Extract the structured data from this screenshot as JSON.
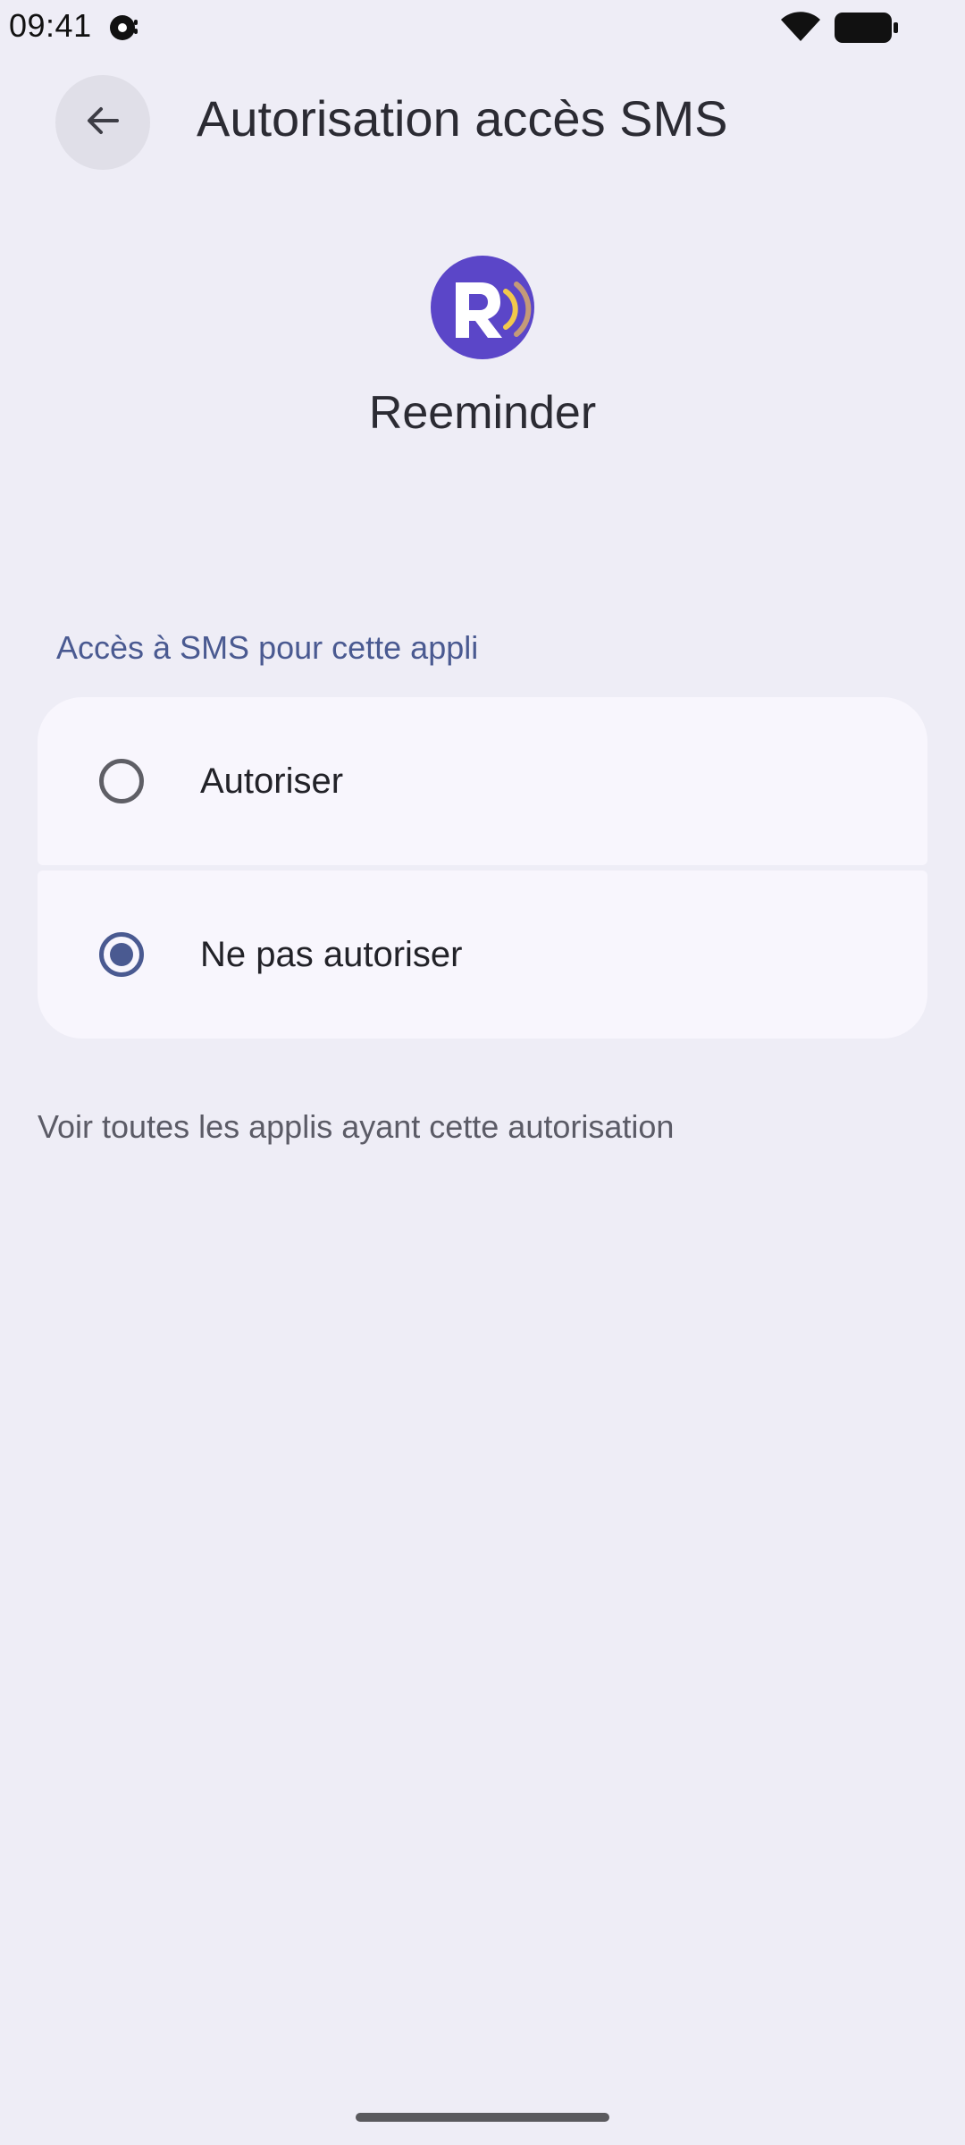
{
  "status_bar": {
    "time": "09:41",
    "notification_icon": "app-notification-icon",
    "wifi_icon": "wifi-icon",
    "battery_icon": "battery-icon"
  },
  "app_bar": {
    "back_icon": "arrow-back-icon",
    "title": "Autorisation accès SMS"
  },
  "app": {
    "name": "Reeminder",
    "icon": "reeminder-logo",
    "icon_colors": {
      "background": "#5b46c8",
      "letter": "#ffffff",
      "wave_inner": "#f2c84b",
      "wave_outer": "#c49a78"
    }
  },
  "section": {
    "header": "Accès à SMS pour cette appli",
    "options": [
      {
        "label": "Autoriser",
        "selected": false
      },
      {
        "label": "Ne pas autoriser",
        "selected": true
      }
    ]
  },
  "link": {
    "label": "Voir toutes les applis ayant cette autorisation"
  },
  "colors": {
    "background": "#eeedf6",
    "card": "#f8f6fd",
    "accent": "#4a5a91",
    "radio_off": "#5f5f66"
  }
}
